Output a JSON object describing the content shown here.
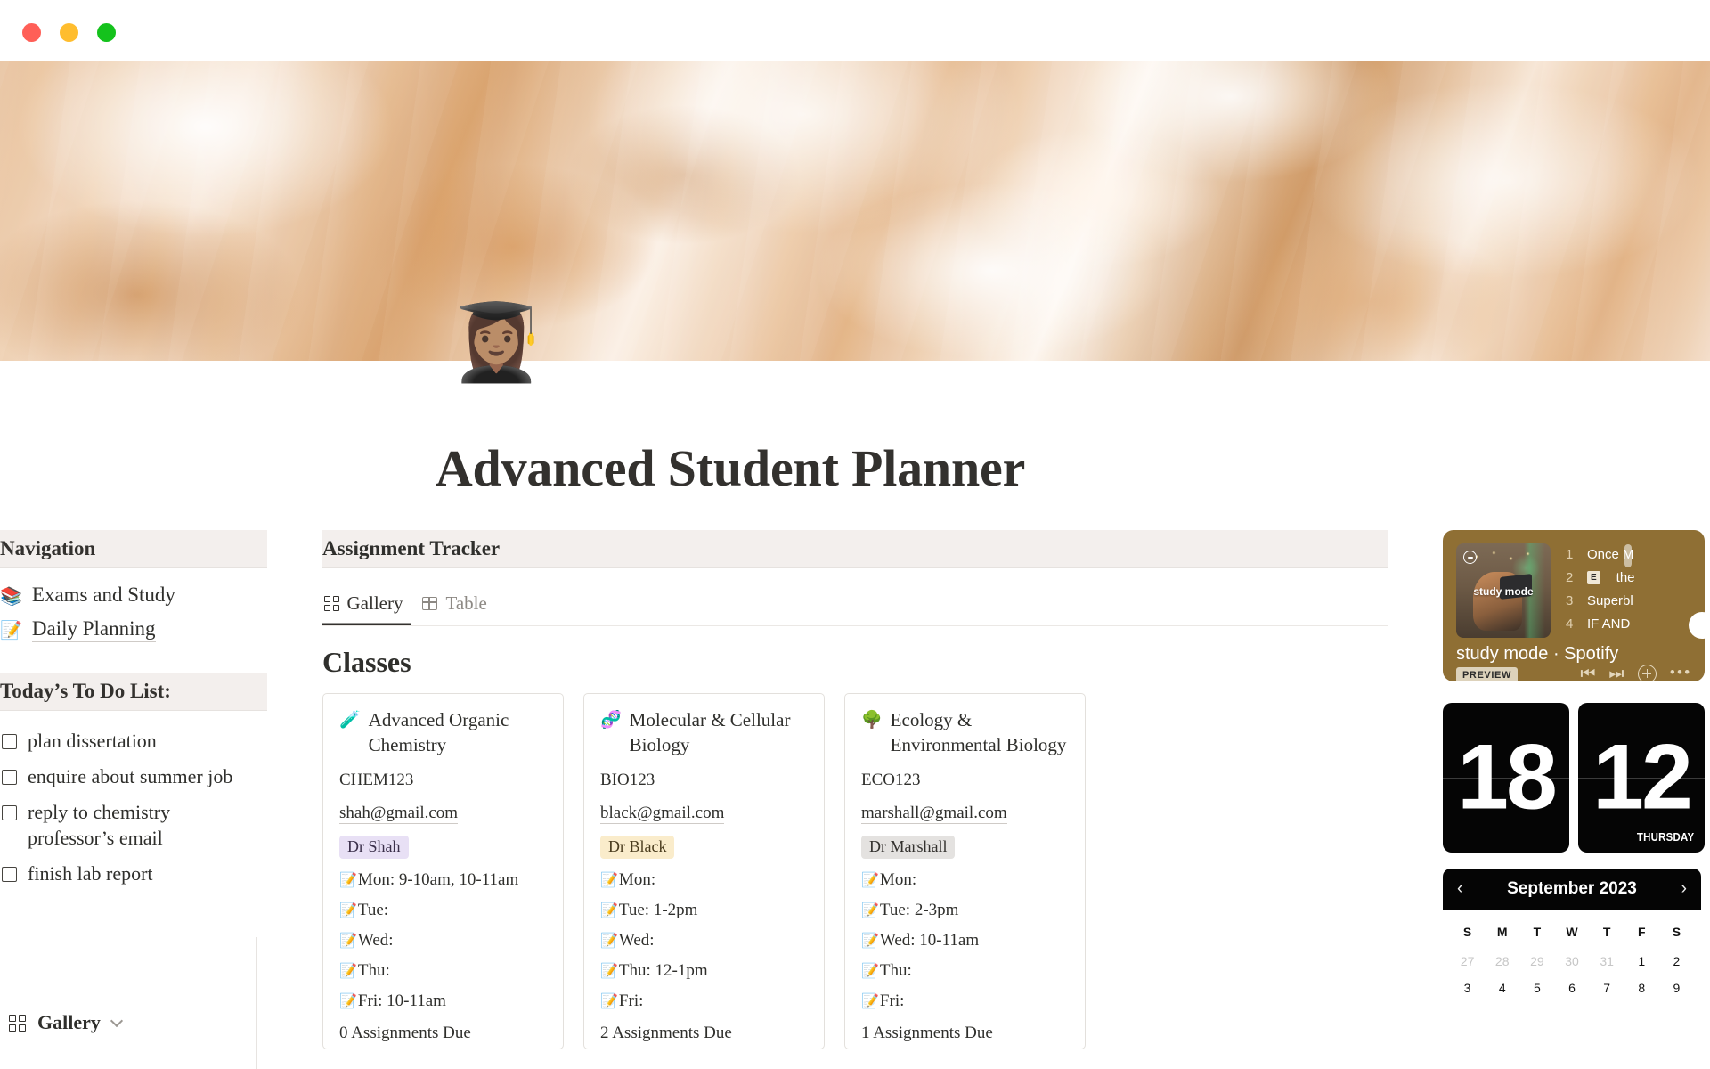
{
  "window": {
    "traffic_lights": [
      "close",
      "minimize",
      "maximize"
    ],
    "colors": {
      "close": "#ff5f57",
      "minimize": "#ffbd2e",
      "maximize": "#14c21c"
    }
  },
  "page": {
    "icon": "👩🏽‍🎓",
    "title": "Advanced Student Planner"
  },
  "sidebar": {
    "navigation_heading": "Navigation",
    "items": [
      {
        "emoji": "📚",
        "label": "Exams and Study"
      },
      {
        "emoji": "📝",
        "label": "Daily Planning"
      }
    ],
    "todo_heading": "Today’s To Do List:",
    "todos": [
      {
        "label": "plan dissertation",
        "checked": false
      },
      {
        "label": "enquire about summer job",
        "checked": false
      },
      {
        "label": "reply to chemistry professor’s email",
        "checked": false
      },
      {
        "label": "finish lab report",
        "checked": false
      }
    ],
    "footer_view": "Gallery"
  },
  "tracker": {
    "heading": "Assignment Tracker",
    "tabs": [
      {
        "label": "Gallery",
        "icon": "grid-icon",
        "active": true
      },
      {
        "label": "Table",
        "icon": "table-icon",
        "active": false
      }
    ],
    "section_title": "Classes",
    "cards": [
      {
        "emoji": "🧪",
        "title": "Advanced Organic Chemistry",
        "code": "CHEM123",
        "email": "shah@gmail.com",
        "professor": "Dr Shah",
        "tag_bg": "#e8e0f5",
        "tag_fg": "#3a2f4a",
        "schedule": [
          {
            "day": "Mon:",
            "time": "9-10am, 10-11am"
          },
          {
            "day": "Tue:",
            "time": ""
          },
          {
            "day": "Wed:",
            "time": ""
          },
          {
            "day": "Thu:",
            "time": ""
          },
          {
            "day": "Fri:",
            "time": "10-11am"
          }
        ],
        "assignments_due": "0 Assignments Due"
      },
      {
        "emoji": "🧬",
        "title": "Molecular & Cellular Biology",
        "code": "BIO123",
        "email": "black@gmail.com",
        "professor": "Dr Black",
        "tag_bg": "#faeccb",
        "tag_fg": "#4a3c1e",
        "schedule": [
          {
            "day": "Mon:",
            "time": ""
          },
          {
            "day": "Tue:",
            "time": "1-2pm"
          },
          {
            "day": "Wed:",
            "time": ""
          },
          {
            "day": "Thu:",
            "time": "12-1pm"
          },
          {
            "day": "Fri:",
            "time": ""
          }
        ],
        "assignments_due": "2 Assignments Due"
      },
      {
        "emoji": "🌳",
        "title": "Ecology & Environmental Biology",
        "code": "ECO123",
        "email": "marshall@gmail.com",
        "professor": "Dr Marshall",
        "tag_bg": "#e4e2e0",
        "tag_fg": "#33312e",
        "schedule": [
          {
            "day": "Mon:",
            "time": ""
          },
          {
            "day": "Tue:",
            "time": "2-3pm"
          },
          {
            "day": "Wed:",
            "time": "10-11am"
          },
          {
            "day": "Thu:",
            "time": ""
          },
          {
            "day": "Fri:",
            "time": ""
          }
        ],
        "assignments_due": "1 Assignments Due"
      }
    ],
    "day_emoji": "📝"
  },
  "widgets": {
    "spotify": {
      "playlist_name": "study mode · Spotify",
      "art_label": "study mode",
      "preview_badge": "PREVIEW",
      "tracks": [
        {
          "num": "1",
          "title": "Once M",
          "explicit": false
        },
        {
          "num": "2",
          "title": "the",
          "explicit": true
        },
        {
          "num": "3",
          "title": "Superbl",
          "explicit": false
        },
        {
          "num": "4",
          "title": "IF AND",
          "explicit": false
        }
      ],
      "explicit_label": "E",
      "controls": [
        "previous",
        "next",
        "add",
        "more"
      ],
      "bg_color": "#8f6f34"
    },
    "clock": {
      "hours": "18",
      "minutes": "12",
      "weekday": "THURSDAY"
    },
    "calendar": {
      "title": "September 2023",
      "prev_label": "‹",
      "next_label": "›",
      "dow": [
        "S",
        "M",
        "T",
        "W",
        "T",
        "F",
        "S"
      ],
      "weeks": [
        [
          {
            "d": "27",
            "muted": true
          },
          {
            "d": "28",
            "muted": true
          },
          {
            "d": "29",
            "muted": true
          },
          {
            "d": "30",
            "muted": true
          },
          {
            "d": "31",
            "muted": true
          },
          {
            "d": "1",
            "muted": false
          },
          {
            "d": "2",
            "muted": false
          }
        ],
        [
          {
            "d": "3",
            "muted": false
          },
          {
            "d": "4",
            "muted": false
          },
          {
            "d": "5",
            "muted": false
          },
          {
            "d": "6",
            "muted": false
          },
          {
            "d": "7",
            "muted": false
          },
          {
            "d": "8",
            "muted": false
          },
          {
            "d": "9",
            "muted": false
          }
        ]
      ]
    }
  }
}
